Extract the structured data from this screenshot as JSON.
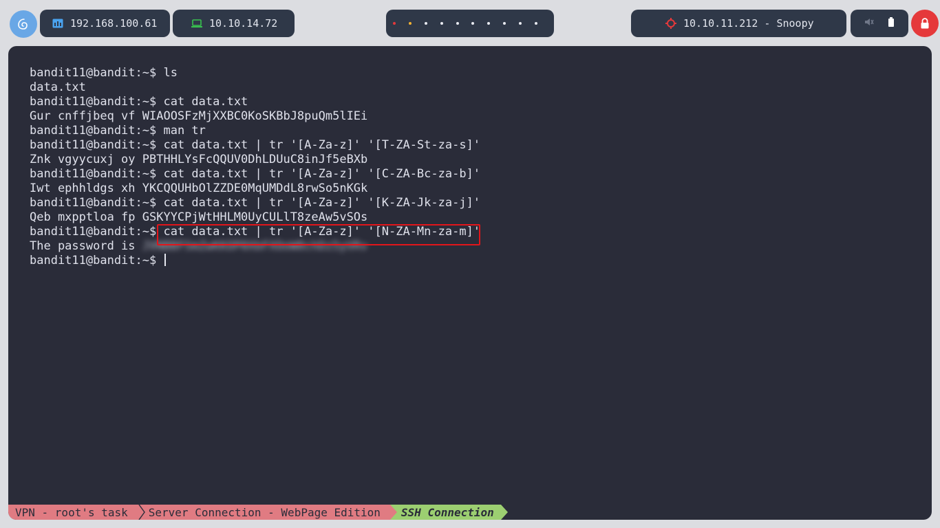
{
  "topbar": {
    "ip_local": "192.168.100.61",
    "ip_vpn": "10.10.14.72",
    "target": "10.10.11.212 - Snoopy",
    "colors": {
      "pill_bg": "#2f3848",
      "launcher": "#69a7e6",
      "lock": "#e5393b",
      "dot_red": "#e5393b",
      "dot_yellow": "#f2b233"
    },
    "icons": [
      "debian-swirl-icon",
      "network-icon",
      "laptop-icon",
      "target-crosshair-icon",
      "mute-icon",
      "battery-icon",
      "lock-icon"
    ]
  },
  "terminal": {
    "lines": [
      {
        "prompt": "bandit11@bandit:~$ ",
        "text": "ls"
      },
      {
        "prompt": "",
        "text": "data.txt"
      },
      {
        "prompt": "bandit11@bandit:~$ ",
        "text": "cat data.txt"
      },
      {
        "prompt": "",
        "text": "Gur cnffjbeq vf WIAOOSFzMjXXBC0KoSKBbJ8puQm5lIEi"
      },
      {
        "prompt": "bandit11@bandit:~$ ",
        "text": "man tr"
      },
      {
        "prompt": "bandit11@bandit:~$ ",
        "text": "cat data.txt | tr '[A-Za-z]' '[T-ZA-St-za-s]'"
      },
      {
        "prompt": "",
        "text": "Znk vgyycuxj oy PBTHHLYsFcQQUV0DhLDUuC8inJf5eBXb"
      },
      {
        "prompt": "bandit11@bandit:~$ ",
        "text": "cat data.txt | tr '[A-Za-z]' '[C-ZA-Bc-za-b]'"
      },
      {
        "prompt": "",
        "text": "Iwt ephhldgs xh YKCQQUHbOlZZDE0MqUMDdL8rwSo5nKGk"
      },
      {
        "prompt": "bandit11@bandit:~$ ",
        "text": "cat data.txt | tr '[A-Za-z]' '[K-ZA-Jk-za-j]'"
      },
      {
        "prompt": "",
        "text": "Qeb mxpptloa fp GSKYYCPjWtHHLM0UyCULlT8zeAw5vSOs"
      },
      {
        "prompt": "bandit11@bandit:~$ ",
        "text": "cat data.txt | tr '[A-Za-z]' '[N-ZA-Mn-za-m]'"
      },
      {
        "prompt": "",
        "text": "The password is ",
        "blurred": "JVNBBFSmZwKKOP0XbFXOoW8chDz5yVRv"
      },
      {
        "prompt": "bandit11@bandit:~$ ",
        "text": "",
        "cursor": true
      }
    ],
    "highlight_color": "#e3151a",
    "background": "#2a2c39"
  },
  "statusbar": {
    "segments": [
      "VPN - root's task",
      "Server Connection - WebPage Edition",
      "SSH Connection"
    ],
    "colors": {
      "inactive": "#e07b82",
      "active": "#9ccf71"
    }
  }
}
